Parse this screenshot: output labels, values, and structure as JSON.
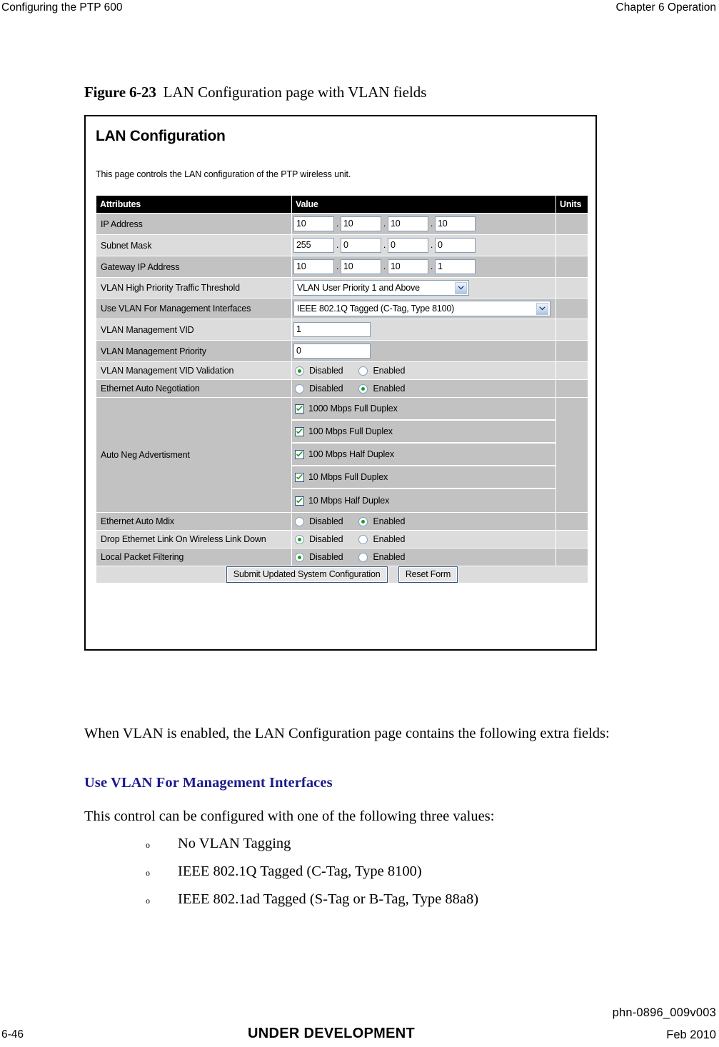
{
  "running_head": {
    "left": "Configuring the PTP 600",
    "right": "Chapter 6 Operation"
  },
  "figure": {
    "number": "Figure 6-23",
    "title": "LAN Configuration page with VLAN fields",
    "screenshot": {
      "page_title": "LAN Configuration",
      "description": "This page controls the LAN configuration of the PTP wireless unit.",
      "table": {
        "headers": {
          "attributes": "Attributes",
          "value": "Value",
          "units": "Units"
        },
        "rows": [
          {
            "attribute": "IP Address",
            "type": "ip",
            "octets": [
              "10",
              "10",
              "10",
              "10"
            ],
            "units": ""
          },
          {
            "attribute": "Subnet Mask",
            "type": "ip",
            "octets": [
              "255",
              "0",
              "0",
              "0"
            ],
            "units": ""
          },
          {
            "attribute": "Gateway IP Address",
            "type": "ip",
            "octets": [
              "10",
              "10",
              "10",
              "1"
            ],
            "units": ""
          },
          {
            "attribute": "VLAN High Priority Traffic Threshold",
            "type": "select",
            "selected": "VLAN User Priority 1 and Above",
            "units": ""
          },
          {
            "attribute": "Use VLAN For Management Interfaces",
            "type": "select",
            "selected": "IEEE 802.1Q Tagged (C-Tag, Type 8100)",
            "units": ""
          },
          {
            "attribute": "VLAN Management VID",
            "type": "text",
            "value": "1",
            "units": ""
          },
          {
            "attribute": "VLAN Management Priority",
            "type": "text",
            "value": "0",
            "units": ""
          },
          {
            "attribute": "VLAN Management VID Validation",
            "type": "radio",
            "options": [
              "Disabled",
              "Enabled"
            ],
            "selected": "Disabled",
            "units": ""
          },
          {
            "attribute": "Ethernet Auto Negotiation",
            "type": "radio",
            "options": [
              "Disabled",
              "Enabled"
            ],
            "selected": "Enabled",
            "units": ""
          },
          {
            "attribute": "Auto Neg Advertisment",
            "type": "checkbox-group",
            "checkboxes": [
              {
                "label": "1000 Mbps Full Duplex",
                "checked": true
              },
              {
                "label": "100 Mbps Full Duplex",
                "checked": true
              },
              {
                "label": "100 Mbps Half Duplex",
                "checked": true
              },
              {
                "label": "10 Mbps Full Duplex",
                "checked": true
              },
              {
                "label": "10 Mbps Half Duplex",
                "checked": true
              }
            ],
            "units": ""
          },
          {
            "attribute": "Ethernet Auto Mdix",
            "type": "radio",
            "options": [
              "Disabled",
              "Enabled"
            ],
            "selected": "Enabled",
            "units": ""
          },
          {
            "attribute": "Drop Ethernet Link On Wireless Link Down",
            "type": "radio",
            "options": [
              "Disabled",
              "Enabled"
            ],
            "selected": "Disabled",
            "units": ""
          },
          {
            "attribute": "Local Packet Filtering",
            "type": "radio",
            "options": [
              "Disabled",
              "Enabled"
            ],
            "selected": "Disabled",
            "units": ""
          }
        ],
        "buttons": {
          "submit": "Submit Updated System Configuration",
          "reset": "Reset Form"
        }
      }
    }
  },
  "body": {
    "intro": "When VLAN is enabled, the LAN Configuration page contains the following extra fields:",
    "sub_heading": "Use VLAN For Management Interfaces",
    "control_intro": "This control can be configured with one of the following three values:",
    "bullets": [
      "No VLAN Tagging",
      "IEEE 802.1Q Tagged (C-Tag, Type 8100)",
      "IEEE 802.1ad Tagged (S-Tag or B-Tag, Type 88a8)"
    ],
    "bullet_marker": "o"
  },
  "footer": {
    "page_number": "6-46",
    "status": "UNDER DEVELOPMENT",
    "doc_id": "phn-0896_009v003",
    "date": "Feb 2010"
  },
  "colors": {
    "heading_blue": "#1a1a8c",
    "row_dark": "#c2c2c2",
    "row_light": "#dcdcdc",
    "header_black": "#000000",
    "check_green": "#18a018",
    "input_border": "#7f9db9"
  }
}
